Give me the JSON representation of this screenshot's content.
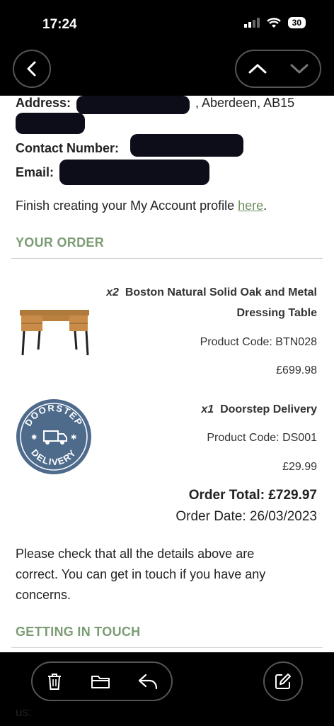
{
  "status_bar": {
    "time": "17:24",
    "battery": "30"
  },
  "address": {
    "label": "Address:",
    "suffix": ", Aberdeen, AB15"
  },
  "contact": {
    "label": "Contact Number:"
  },
  "email": {
    "label": "Email:"
  },
  "finish_text": "Finish creating your My Account profile ",
  "finish_link": "here",
  "finish_period": ".",
  "your_order_title": "YOUR ORDER",
  "items": [
    {
      "qty": "x2",
      "name_line1": "Boston Natural Solid Oak and Metal",
      "name_line2": "Dressing Table",
      "code": "Product Code: BTN028",
      "price": "£699.98"
    },
    {
      "qty": "x1",
      "name_line1": "Doorstep Delivery",
      "code": "Product Code: DS001",
      "price": "£29.99"
    }
  ],
  "delivery_logo": {
    "top": "DOORSTEP",
    "bottom": "DELIVERY"
  },
  "order_total": "Order Total: £729.97",
  "order_date": "Order Date: 26/03/2023",
  "check_text": [
    "Please check that all the details above are",
    "correct. You can get in touch if you have any",
    "concerns."
  ],
  "getting_in_touch_title": "GETTING IN TOUCH",
  "footer_partial": "us:",
  "colors": {
    "accent_green": "#7b9c74",
    "delivery_blue": "#4e6b8c"
  }
}
